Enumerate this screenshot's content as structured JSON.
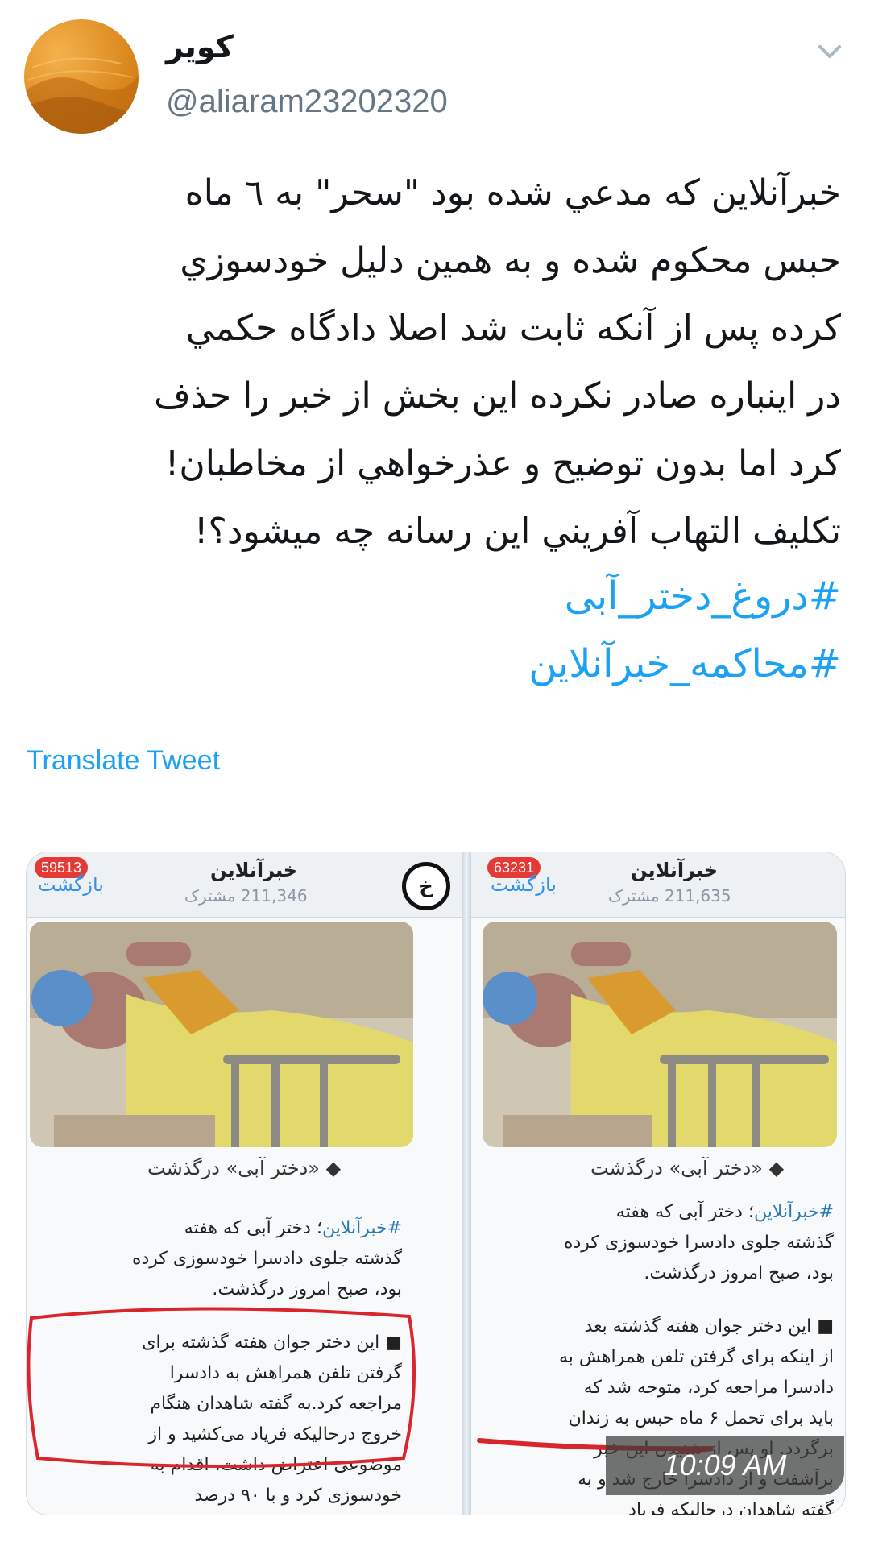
{
  "tweet": {
    "display_name": "کویر",
    "handle": "@aliaram23202320",
    "text": "خبرآنلاین که مدعي شده بود \"سحر\" به ٦ ماه\nحبس محکوم شده و به همین دلیل خودسوزي\nکرده پس از آنکه ثابت شد اصلا دادگاه حکمي\nدر اینباره صادر نکرده این بخش از خبر را حذف\nکرد اما بدون توضیح و عذرخواهي از مخاطبان!\nتکلیف التهاب آفریني این رسانه چه میشود؟!",
    "hashtags": [
      "#دروغ_دختر_آبی",
      "#محاکمه_خبرآنلاین"
    ],
    "translate_label": "Translate Tweet",
    "timestamp": "10:09 AM"
  },
  "media": {
    "left": {
      "channel_name": "خبرآنلاین",
      "subscribers": "211,346 مشترک",
      "back_label": "بازگشت",
      "badge": "59513",
      "caption": "◆ «دختر آبی» درگذشت",
      "para1_tag": "#خبرآنلاین",
      "para1_text": "؛ دختر آبی که هفته\nگذشته جلوی دادسرا خودسوزی کرده\nبود، صبح امروز درگذشت.",
      "para2_text": "■ این دختر جوان هفته گذشته برای\nگرفتن تلفن همراهش به دادسرا\nمراجعه کرد.به گفته شاهدان هنگام\nخروج درحالیکه فریاد می‌کشید و از\nموضوعی اعتراض داشت، اقدام به\nخودسوزی کرد و با ۹۰ درصد"
    },
    "right": {
      "channel_name": "خبرآنلاین",
      "subscribers": "211,635 مشترک",
      "back_label": "بازگشت",
      "badge": "63231",
      "caption": "◆ «دختر آبی» درگذشت",
      "para1_tag": "#خبرآنلاین",
      "para1_text": "؛ دختر آبی که هفته\nگذشته جلوی دادسرا خودسوزی کرده\nبود، صبح امروز درگذشت.",
      "para2_text": "■ این دختر جوان هفته گذشته بعد\nاز اینکه برای گرفتن تلفن همراهش به\nدادسرا مراجعه کرد، متوجه شد که\nباید برای تحمل ۶ ماه حبس به زندان\nبرگردد. او پس از شنیدن این خبر\nبرآشفت و از دادسرا خارج شد و به\nگفته شاهدان درحالیکه فریاد"
    }
  },
  "colors": {
    "link": "#1da1f2",
    "annotation": "#d9262c",
    "badge": "#e53935"
  }
}
